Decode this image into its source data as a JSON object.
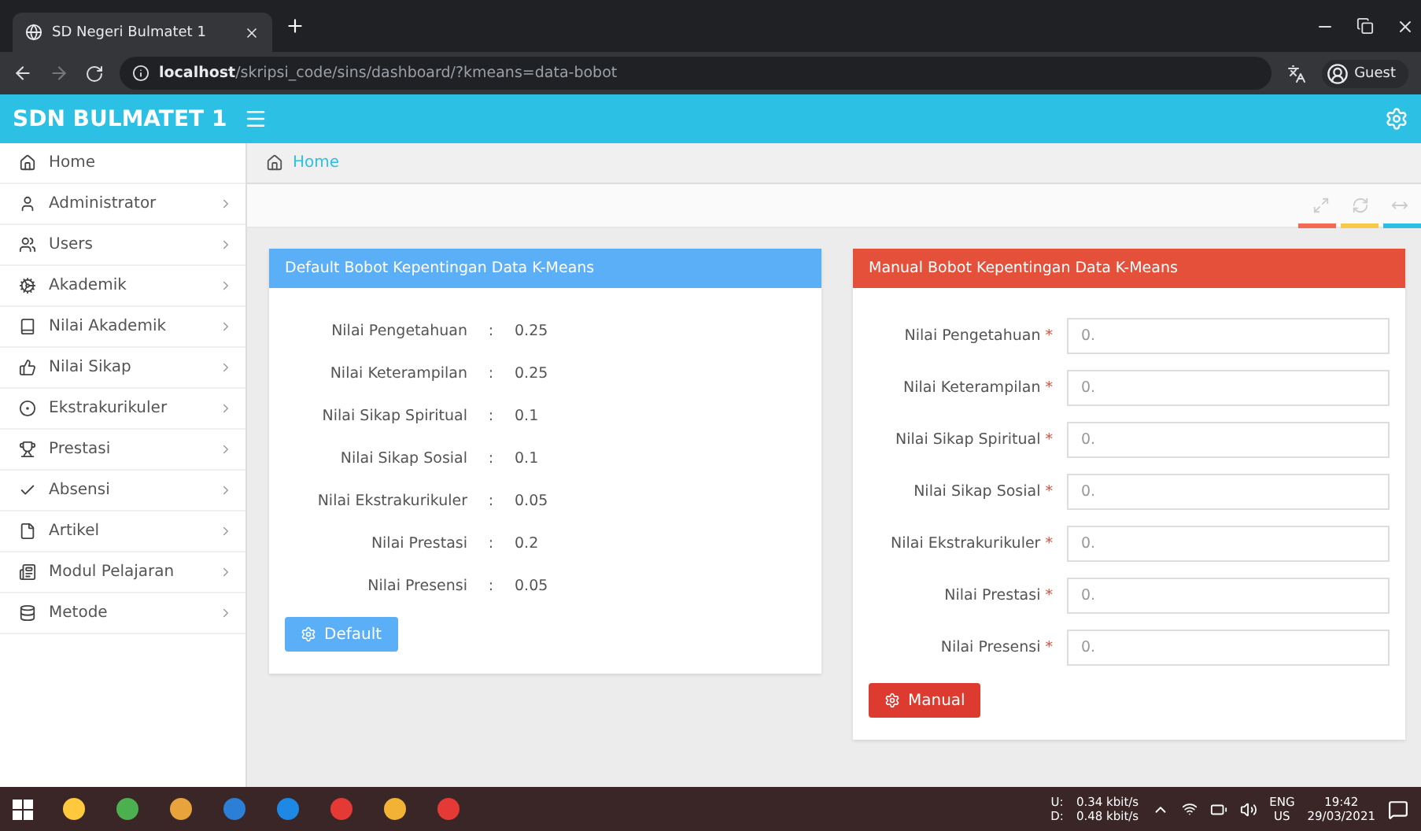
{
  "browser": {
    "tab_title": "SD Negeri Bulmatet 1",
    "url_host": "localhost",
    "url_path": "/skripsi_code/sins/dashboard/?kmeans=data-bobot",
    "profile": "Guest"
  },
  "app": {
    "brand": "SDN BULMATET 1"
  },
  "sidebar": {
    "items": [
      {
        "label": "Home",
        "has_submenu": false
      },
      {
        "label": "Administrator",
        "has_submenu": true
      },
      {
        "label": "Users",
        "has_submenu": true
      },
      {
        "label": "Akademik",
        "has_submenu": true
      },
      {
        "label": "Nilai Akademik",
        "has_submenu": true
      },
      {
        "label": "Nilai Sikap",
        "has_submenu": true
      },
      {
        "label": "Ekstrakurikuler",
        "has_submenu": true
      },
      {
        "label": "Prestasi",
        "has_submenu": true
      },
      {
        "label": "Absensi",
        "has_submenu": true
      },
      {
        "label": "Artikel",
        "has_submenu": true
      },
      {
        "label": "Modul Pelajaran",
        "has_submenu": true
      },
      {
        "label": "Metode",
        "has_submenu": true
      }
    ]
  },
  "breadcrumb": "Home",
  "default_panel": {
    "title": "Default Bobot Kepentingan Data K-Means",
    "rows": [
      {
        "label": "Nilai Pengetahuan",
        "sep": ":",
        "value": "0.25"
      },
      {
        "label": "Nilai Keterampilan",
        "sep": ":",
        "value": "0.25"
      },
      {
        "label": "Nilai Sikap Spiritual",
        "sep": ":",
        "value": "0.1"
      },
      {
        "label": "Nilai Sikap Sosial",
        "sep": ":",
        "value": "0.1"
      },
      {
        "label": "Nilai Ekstrakurikuler",
        "sep": ":",
        "value": "0.05"
      },
      {
        "label": "Nilai Prestasi",
        "sep": ":",
        "value": "0.2"
      },
      {
        "label": "Nilai Presensi",
        "sep": ":",
        "value": "0.05"
      }
    ],
    "button": "Default"
  },
  "manual_panel": {
    "title": "Manual Bobot Kepentingan Data K-Means",
    "fields": [
      {
        "label": "Nilai Pengetahuan",
        "mark": "*",
        "placeholder": "0."
      },
      {
        "label": "Nilai Keterampilan",
        "mark": "*",
        "placeholder": "0."
      },
      {
        "label": "Nilai Sikap Spiritual",
        "mark": "*",
        "placeholder": "0."
      },
      {
        "label": "Nilai Sikap Sosial",
        "mark": "*",
        "placeholder": "0."
      },
      {
        "label": "Nilai Ekstrakurikuler",
        "mark": "*",
        "placeholder": "0."
      },
      {
        "label": "Nilai Prestasi",
        "mark": "*",
        "placeholder": "0."
      },
      {
        "label": "Nilai Presensi",
        "mark": "*",
        "placeholder": "0."
      }
    ],
    "button": "Manual"
  },
  "taskbar": {
    "tray": {
      "up_label": "U:",
      "down_label": "D:",
      "up_rate": "0.34 kbit/s",
      "down_rate": "0.48 kbit/s",
      "lang": "ENG",
      "region": "US",
      "time": "19:42",
      "date": "29/03/2021"
    }
  }
}
